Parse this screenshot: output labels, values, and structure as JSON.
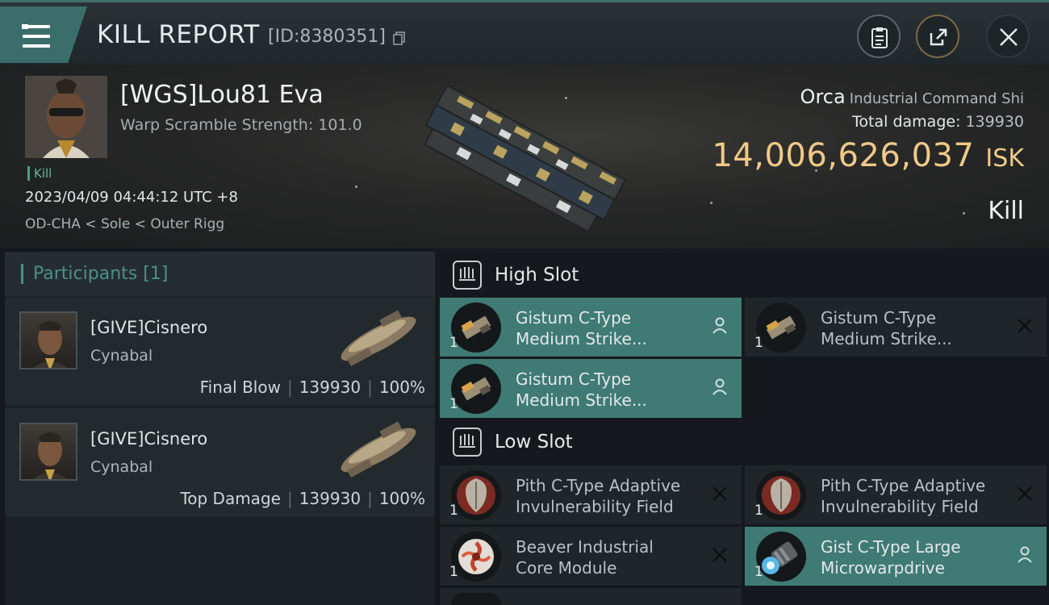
{
  "header": {
    "title": "KILL REPORT",
    "report_id": "[ID:8380351]",
    "menu_icon": "hamburger-menu-icon",
    "buttons": [
      "clipboard-icon",
      "share-icon",
      "close-icon"
    ]
  },
  "victim": {
    "name": "[WGS]Lou81 Eva",
    "warp_scramble": "Warp Scramble Strength: 101.0",
    "tag": "Kill",
    "timestamp": "2023/04/09 04:44:12 UTC +8",
    "location": "OD-CHA < Sole < Outer Rigg",
    "ship_name": "Orca",
    "ship_class": "Industrial Command Shi",
    "total_damage_label": "Total damage:",
    "total_damage": "139930",
    "isk_value": "14,006,626,037",
    "isk_unit": "ISK",
    "kill_type": "Kill"
  },
  "participants": {
    "header": "Participants [1]",
    "rows": [
      {
        "name": "[GIVE]Cisnero",
        "ship": "Cynabal",
        "role": "Final Blow",
        "damage": "139930",
        "percent": "100%"
      },
      {
        "name": "[GIVE]Cisnero",
        "ship": "Cynabal",
        "role": "Top Damage",
        "damage": "139930",
        "percent": "100%"
      }
    ]
  },
  "fitting": {
    "high_slot": {
      "label": "High Slot",
      "modules": [
        {
          "line1": "Gistum C-Type",
          "line2": "Medium Strike...",
          "qty": "1",
          "status": "dropped",
          "icon": "missile-launcher-icon"
        },
        {
          "line1": "Gistum C-Type",
          "line2": "Medium Strike...",
          "qty": "1",
          "status": "destroyed",
          "icon": "missile-launcher-icon"
        },
        {
          "line1": "Gistum C-Type",
          "line2": "Medium Strike...",
          "qty": "1",
          "status": "dropped",
          "icon": "missile-launcher-icon"
        }
      ]
    },
    "low_slot": {
      "label": "Low Slot",
      "modules": [
        {
          "line1": "Pith C-Type Adaptive",
          "line2": "Invulnerability Field",
          "qty": "1",
          "status": "destroyed",
          "icon": "shield-module-icon"
        },
        {
          "line1": "Pith C-Type Adaptive",
          "line2": "Invulnerability Field",
          "qty": "1",
          "status": "destroyed",
          "icon": "shield-module-icon"
        },
        {
          "line1": "Beaver Industrial",
          "line2": "Core Module",
          "qty": "1",
          "status": "destroyed",
          "icon": "industrial-core-icon"
        },
        {
          "line1": "Gist C-Type Large",
          "line2": "Microwarpdrive",
          "qty": "1",
          "status": "dropped",
          "icon": "microwarpdrive-icon"
        }
      ]
    }
  },
  "colors": {
    "accent_teal": "#3f7a74",
    "isk_gold": "#f0c987",
    "background": "#15191d"
  }
}
